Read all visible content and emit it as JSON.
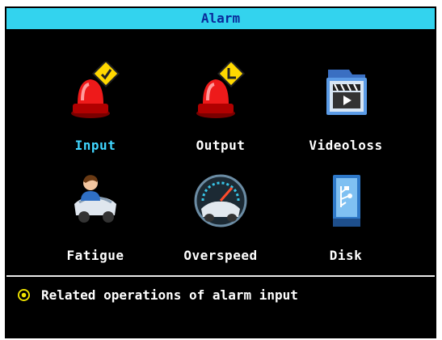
{
  "window": {
    "title": "Alarm"
  },
  "menu": {
    "items": [
      {
        "label": "Input",
        "icon": "alarm-input-icon",
        "selected": true
      },
      {
        "label": "Output",
        "icon": "alarm-output-icon",
        "selected": false
      },
      {
        "label": "Videoloss",
        "icon": "video-loss-icon",
        "selected": false
      },
      {
        "label": "Fatigue",
        "icon": "fatigue-driver-icon",
        "selected": false
      },
      {
        "label": "Overspeed",
        "icon": "overspeed-icon",
        "selected": false
      },
      {
        "label": "Disk",
        "icon": "disk-icon",
        "selected": false
      }
    ]
  },
  "status": {
    "icon": "info-circle-icon",
    "text": "Related operations of alarm input"
  },
  "colors": {
    "title_bg": "#33d3ee",
    "title_text": "#0a2a9a",
    "selected_label": "#40d6ff",
    "background": "#000000",
    "label": "#ffffff",
    "status_icon": "#f2e600"
  }
}
